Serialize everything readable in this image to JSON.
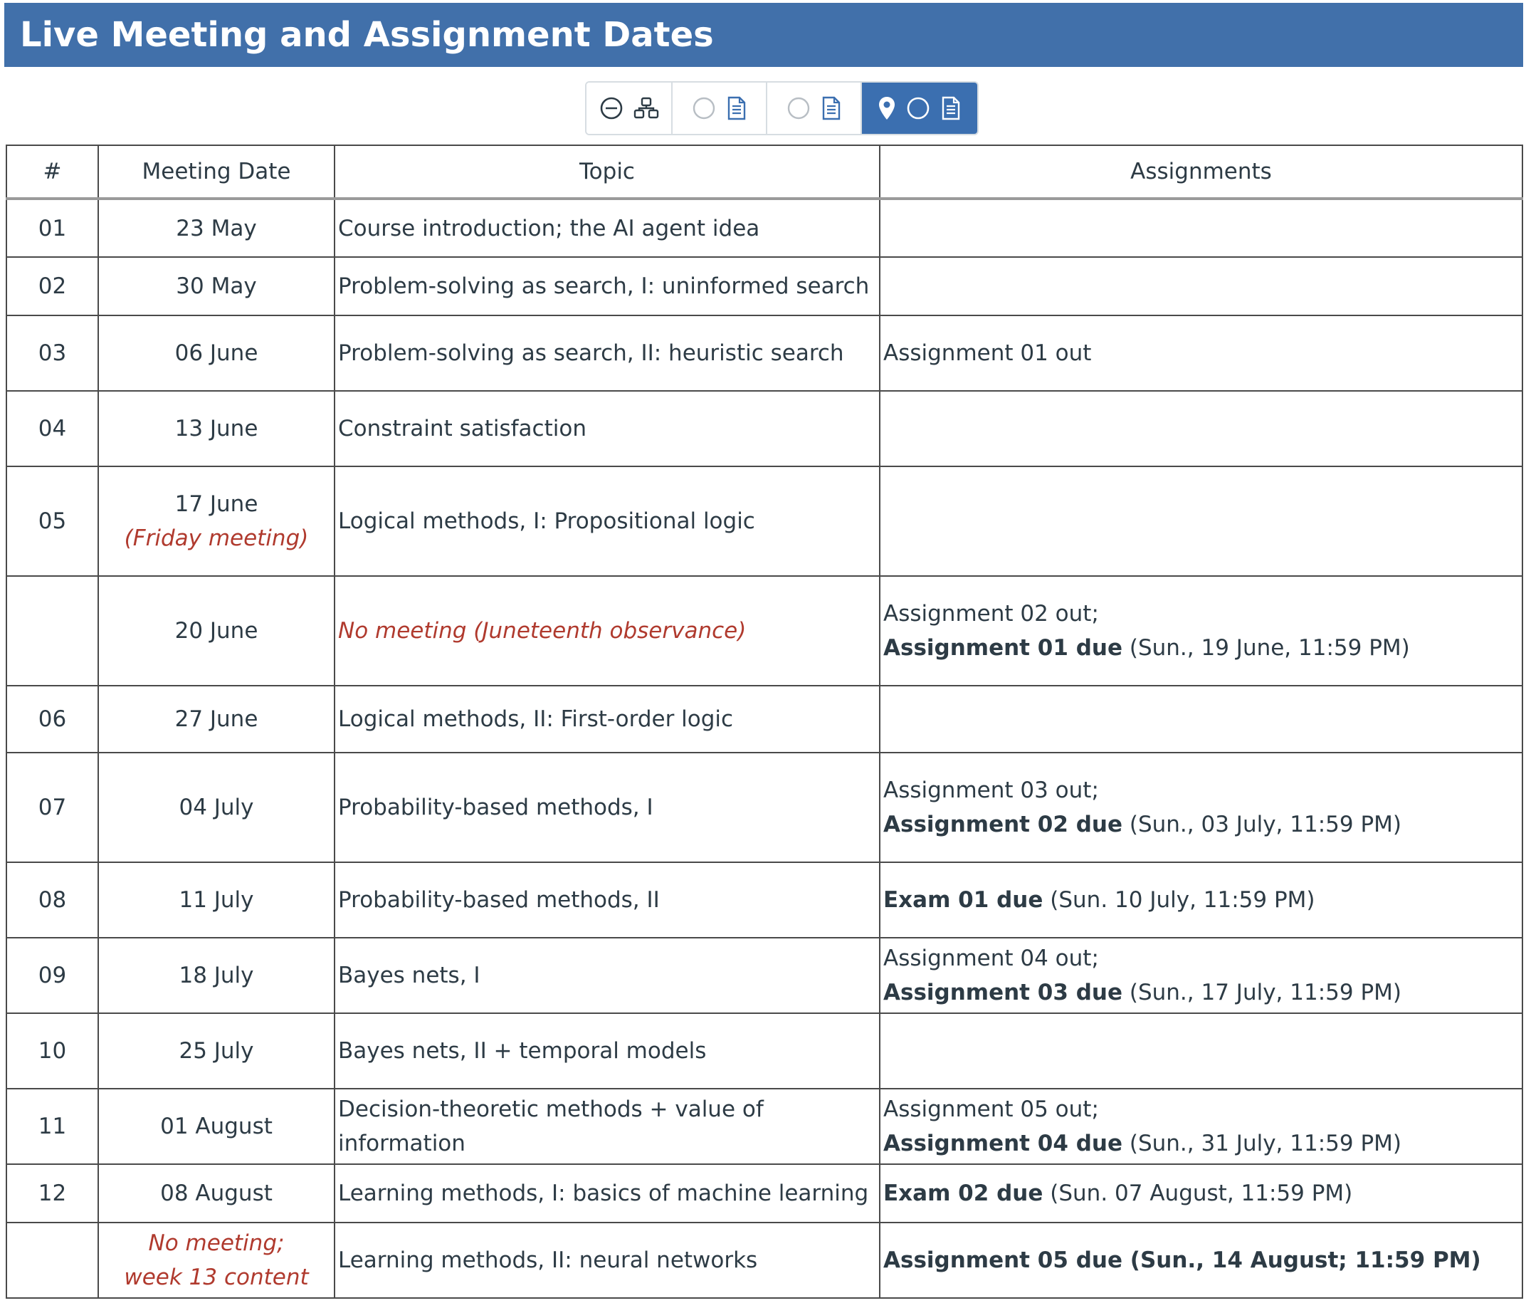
{
  "page": {
    "title": "Live Meeting and Assignment Dates"
  },
  "toolbar": {
    "buttons": [
      {
        "name": "view-collapse",
        "icons": [
          "minus-circle-icon",
          "hierarchy-icon"
        ],
        "selected": false
      },
      {
        "name": "view-outline",
        "icons": [
          "circle-outline-icon",
          "document-icon"
        ],
        "selected": false
      },
      {
        "name": "view-outline-2",
        "icons": [
          "circle-outline-icon",
          "document-icon"
        ],
        "selected": false
      },
      {
        "name": "view-located",
        "icons": [
          "location-pin-icon",
          "circle-outline-icon",
          "document-icon"
        ],
        "selected": true
      }
    ]
  },
  "table": {
    "headers": {
      "num": "#",
      "date": "Meeting Date",
      "topic": "Topic",
      "assignments": "Assignments"
    },
    "rows": [
      {
        "num": "01",
        "date": "23 May",
        "topic": "Course introduction; the AI agent idea"
      },
      {
        "num": "02",
        "date": "30 May",
        "topic": "Problem-solving as search, I: uninformed search"
      },
      {
        "num": "03",
        "date": "06 June",
        "topic": "Problem-solving as search, II: heuristic search",
        "assign1": "Assignment 01 out"
      },
      {
        "num": "04",
        "date": "13 June",
        "topic": "Constraint satisfaction"
      },
      {
        "num": "05",
        "date": "17 June",
        "date_note": "(Friday meeting)",
        "topic": "Logical methods, I: Propositional logic"
      },
      {
        "num": "",
        "date": "20 June",
        "topic_note": "No meeting (Juneteenth observance)",
        "assign1": "Assignment 02 out;",
        "assign_bold": "Assignment 01 due",
        "assign_rest": " (Sun., 19 June, 11:59 PM)"
      },
      {
        "num": "06",
        "date": "27 June",
        "topic": "Logical methods, II: First-order logic"
      },
      {
        "num": "07",
        "date": "04 July",
        "topic": "Probability-based methods, I",
        "assign1": "Assignment 03 out;",
        "assign_bold": "Assignment 02 due",
        "assign_rest": " (Sun., 03 July, 11:59 PM)"
      },
      {
        "num": "08",
        "date": "11 July",
        "topic": "Probability-based methods, II",
        "assign_bold": "Exam 01 due",
        "assign_rest": " (Sun. 10 July, 11:59 PM)"
      },
      {
        "num": "09",
        "date": "18 July",
        "topic": "Bayes nets, I",
        "assign1": "Assignment 04 out;",
        "assign_bold": "Assignment 03 due",
        "assign_rest": " (Sun., 17 July, 11:59 PM)"
      },
      {
        "num": "10",
        "date": "25 July",
        "topic": "Bayes nets, II + temporal models"
      },
      {
        "num": "11",
        "date": "01 August",
        "topic": "Decision-theoretic methods + value of information",
        "assign1": "Assignment 05 out;",
        "assign_bold": "Assignment 04 due",
        "assign_rest": " (Sun., 31 July, 11:59 PM)"
      },
      {
        "num": "12",
        "date": "08 August",
        "topic": "Learning methods, I: basics of machine learning",
        "assign_bold": "Exam 02 due",
        "assign_rest": " (Sun. 07 August, 11:59 PM)"
      },
      {
        "num": "",
        "date_note1": "No meeting;",
        "date_note2": "week 13 content",
        "topic": "Learning methods, II: neural networks",
        "assign_bold": "Assignment 05 due (Sun., 14 August; 11:59 PM)"
      }
    ]
  },
  "colors": {
    "banner": "#4170aa",
    "selected_button": "#3b6fb0",
    "note_red": "#b03a2e",
    "text": "#2d3b45"
  }
}
